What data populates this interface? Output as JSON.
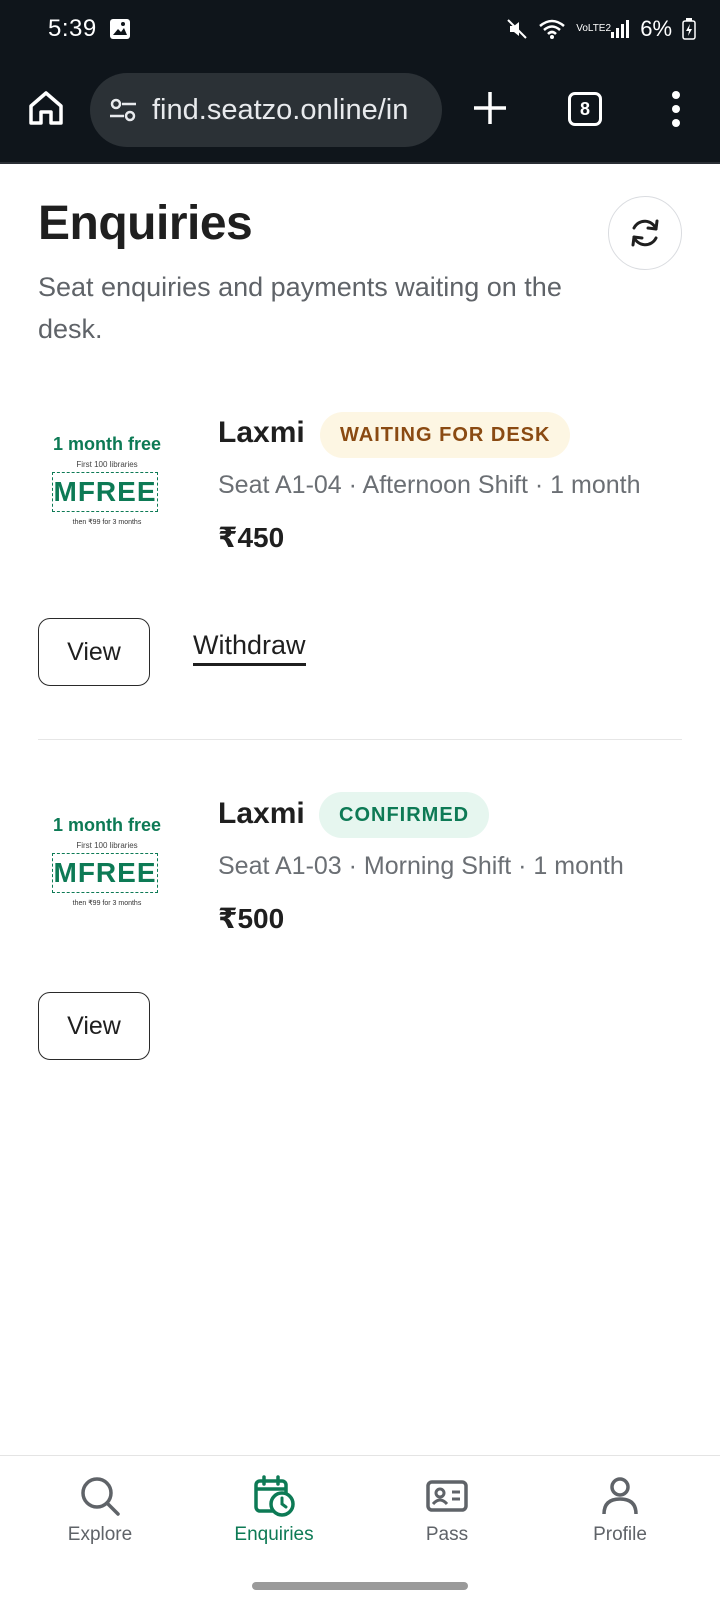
{
  "status_bar": {
    "time": "5:39",
    "battery": "6%",
    "network": "VoLTE2"
  },
  "browser": {
    "url": "find.seatzo.online/in",
    "tab_count": "8"
  },
  "page": {
    "title": "Enquiries",
    "subtitle": "Seat enquiries and payments waiting on the desk."
  },
  "enquiries": [
    {
      "name": "Laxmi",
      "status": "WAITING FOR DESK",
      "details": "Seat A1-04 · Afternoon Shift · 1 month",
      "price": "₹450",
      "view_label": "View",
      "withdraw_label": "Withdraw",
      "promo": {
        "headline": "1 month free",
        "subline": "First 100 libraries",
        "code": "MFREE",
        "footer": "then ₹99 for 3 months"
      }
    },
    {
      "name": "Laxmi",
      "status": "CONFIRMED",
      "details": "Seat A1-03 · Morning Shift · 1 month",
      "price": "₹500",
      "view_label": "View",
      "promo": {
        "headline": "1 month free",
        "subline": "First 100 libraries",
        "code": "MFREE",
        "footer": "then ₹99 for 3 months"
      }
    }
  ],
  "bottom_nav": [
    {
      "label": "Explore",
      "icon": "search-icon",
      "active": false
    },
    {
      "label": "Enquiries",
      "icon": "calendar-clock-icon",
      "active": true
    },
    {
      "label": "Pass",
      "icon": "id-card-icon",
      "active": false
    },
    {
      "label": "Profile",
      "icon": "person-icon",
      "active": false
    }
  ],
  "colors": {
    "accent": "#0d7a55",
    "waiting_bg": "#fdf6e3",
    "waiting_text": "#8a4a12",
    "confirmed_bg": "#e6f6ef",
    "status_bar": "#0f151b"
  }
}
